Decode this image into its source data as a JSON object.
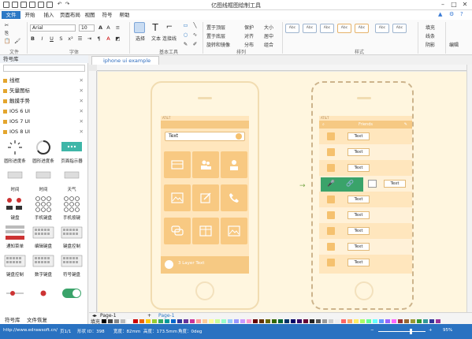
{
  "app": {
    "title": "亿图线框图绘制工具",
    "menu": [
      "文件",
      "开始",
      "插入",
      "页面布局",
      "视图",
      "符号",
      "帮助"
    ],
    "active_menu": "文件"
  },
  "ribbon": {
    "font_name": "Arial",
    "font_size": "10",
    "select_label": "选择",
    "text_label": "文本",
    "connector_label": "连接线",
    "arrange": {
      "bring_front": "置于顶层",
      "send_back": "置于底层",
      "rotate_flip": "旋转和镜像",
      "align": "对齐",
      "distribute": "分布",
      "center": "居中",
      "group": "组合",
      "size": "大小",
      "protect": "保护"
    },
    "style_swatch": "Abc",
    "fill_label": "填充",
    "line_label": "线条",
    "shadow_label": "阴影",
    "edit_label": "编辑",
    "groups": [
      "文件",
      "字体",
      "基本工具",
      "排列",
      "样式"
    ]
  },
  "library": {
    "header": "符号库",
    "categories": [
      "线框",
      "矢量图标",
      "触摸手势",
      "IOS 6 UI",
      "IOS 7 UI",
      "IOS 8 UI"
    ],
    "items": [
      "圆形进度条",
      "圆形进度条",
      "页面指示器",
      "时间",
      "时间",
      "天气",
      "键盘",
      "手机键盘",
      "手机按键",
      "通知菜单",
      "编辑键盘",
      "键盘控制",
      "键盘控制",
      "数字键盘",
      "符号键盘"
    ],
    "bottom_tabs": [
      "符号库",
      "文件恢复"
    ]
  },
  "document": {
    "tab": "iphone ui example",
    "phone1": {
      "carrier": "AT&T",
      "search_text": "Text",
      "bottom_text": "3 Layer Text"
    },
    "phone2": {
      "carrier": "AT&T",
      "nav_title": "Friends",
      "row_label": "Text",
      "rows": [
        "Text",
        "Text",
        "Text",
        "Text",
        "Text",
        "Text",
        "Text",
        "Text",
        "Text"
      ]
    }
  },
  "pagebar": {
    "page_tab": "Page-1",
    "page_tab2": "Page-1",
    "fill_label": "填充"
  },
  "statusbar": {
    "url": "http://www.edrawsoft.cn/",
    "page": "页1/1",
    "shape_id": "形状 ID：398",
    "width": "宽度：82mm",
    "height": "高度：173.5mm",
    "angle": "角度：0deg",
    "zoom": "95%"
  },
  "colors": {
    "accent": "#2b78c5",
    "phone_fill": "#ffe6bd",
    "tile": "#f8c982",
    "swipe_green": "#3aa36a"
  }
}
